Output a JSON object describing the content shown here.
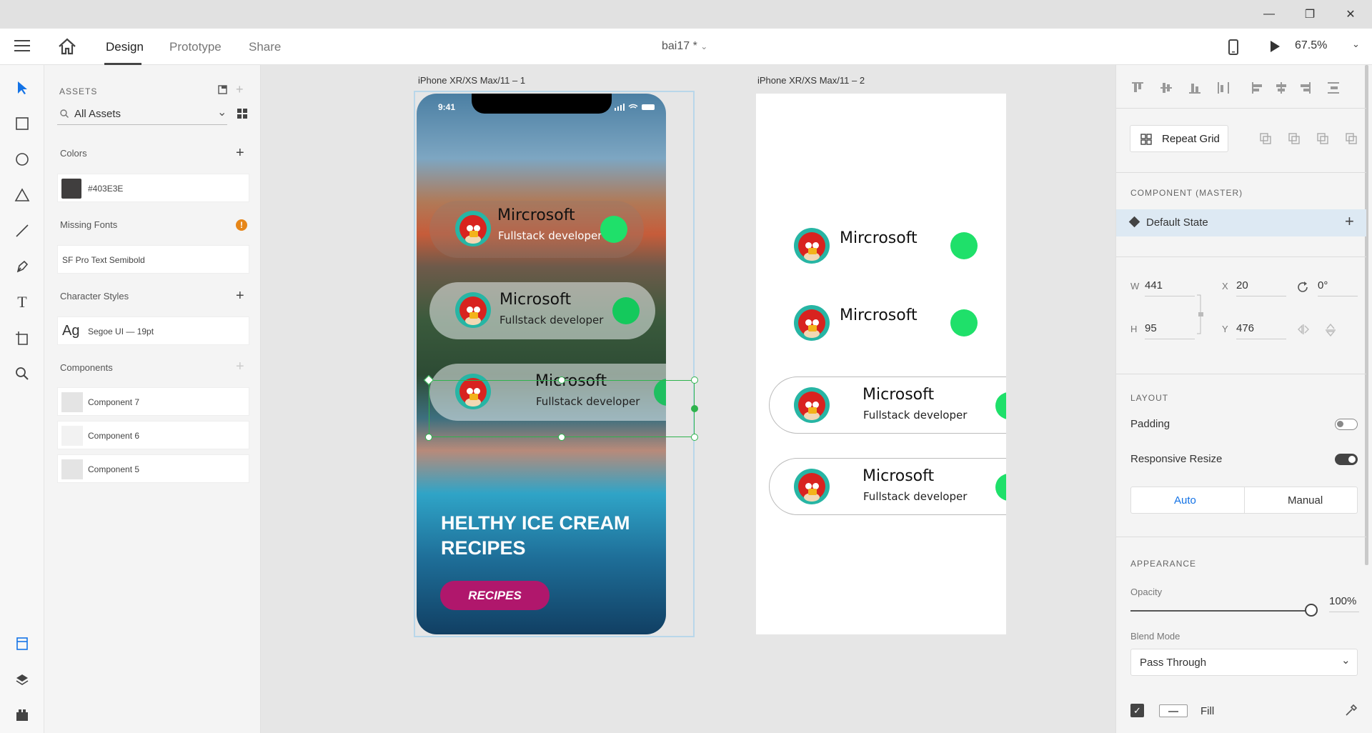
{
  "window": {
    "min_icon": "minimize-icon",
    "max_icon": "maximize-icon",
    "close_icon": "close-icon"
  },
  "toolbar": {
    "tabs": [
      "Design",
      "Prototype",
      "Share"
    ],
    "doc_title": "bai17 *",
    "zoom": "67.5%"
  },
  "assets": {
    "header": "ASSETS",
    "search": "All Assets",
    "colors_label": "Colors",
    "color_value": "#403E3E",
    "missing_fonts_label": "Missing Fonts",
    "missing_font": "SF Pro Text Semibold",
    "char_styles_label": "Character Styles",
    "char_style_sample": "Ag",
    "char_style": "Segoe UI — 19pt",
    "components_label": "Components",
    "components": [
      "Component 7",
      "Component 6",
      "Component 5"
    ]
  },
  "canvas": {
    "artboard1_label": "iPhone XR/XS Max/11 – 1",
    "artboard2_label": "iPhone XR/XS Max/11 – 2",
    "status_time": "9:41",
    "cards": [
      {
        "name": "Mircrosoft",
        "role": "Fullstack developer"
      },
      {
        "name": "Microsoft",
        "role": "Fullstack developer"
      },
      {
        "name": "Microsoft",
        "role": "Fullstack developer"
      }
    ],
    "headline_line1": "HELTHY ICE CREAM",
    "headline_line2": "RECIPES",
    "button": "RECIPES",
    "ab2_cards": [
      {
        "name": "Mircrosoft"
      },
      {
        "name": "Mircrosoft"
      },
      {
        "name": "Microsoft",
        "role": "Fullstack developer"
      },
      {
        "name": "Microsoft",
        "role": "Fullstack developer"
      }
    ]
  },
  "props": {
    "repeat_grid": "Repeat Grid",
    "component_header": "COMPONENT (MASTER)",
    "default_state": "Default State",
    "w_label": "W",
    "w": "441",
    "h_label": "H",
    "h": "95",
    "x_label": "X",
    "x": "20",
    "y_label": "Y",
    "y": "476",
    "rotation": "0°",
    "layout_header": "LAYOUT",
    "padding": "Padding",
    "responsive": "Responsive Resize",
    "auto": "Auto",
    "manual": "Manual",
    "appearance_header": "APPEARANCE",
    "opacity_label": "Opacity",
    "opacity_value": "100%",
    "opacity_level": 1.0,
    "blend_label": "Blend Mode",
    "blend_value": "Pass Through",
    "fill": "Fill"
  },
  "colors": {
    "accent": "#1fe06a",
    "button": "#b0176c",
    "selection": "#2eb34d",
    "swatch": "#403E3E"
  }
}
